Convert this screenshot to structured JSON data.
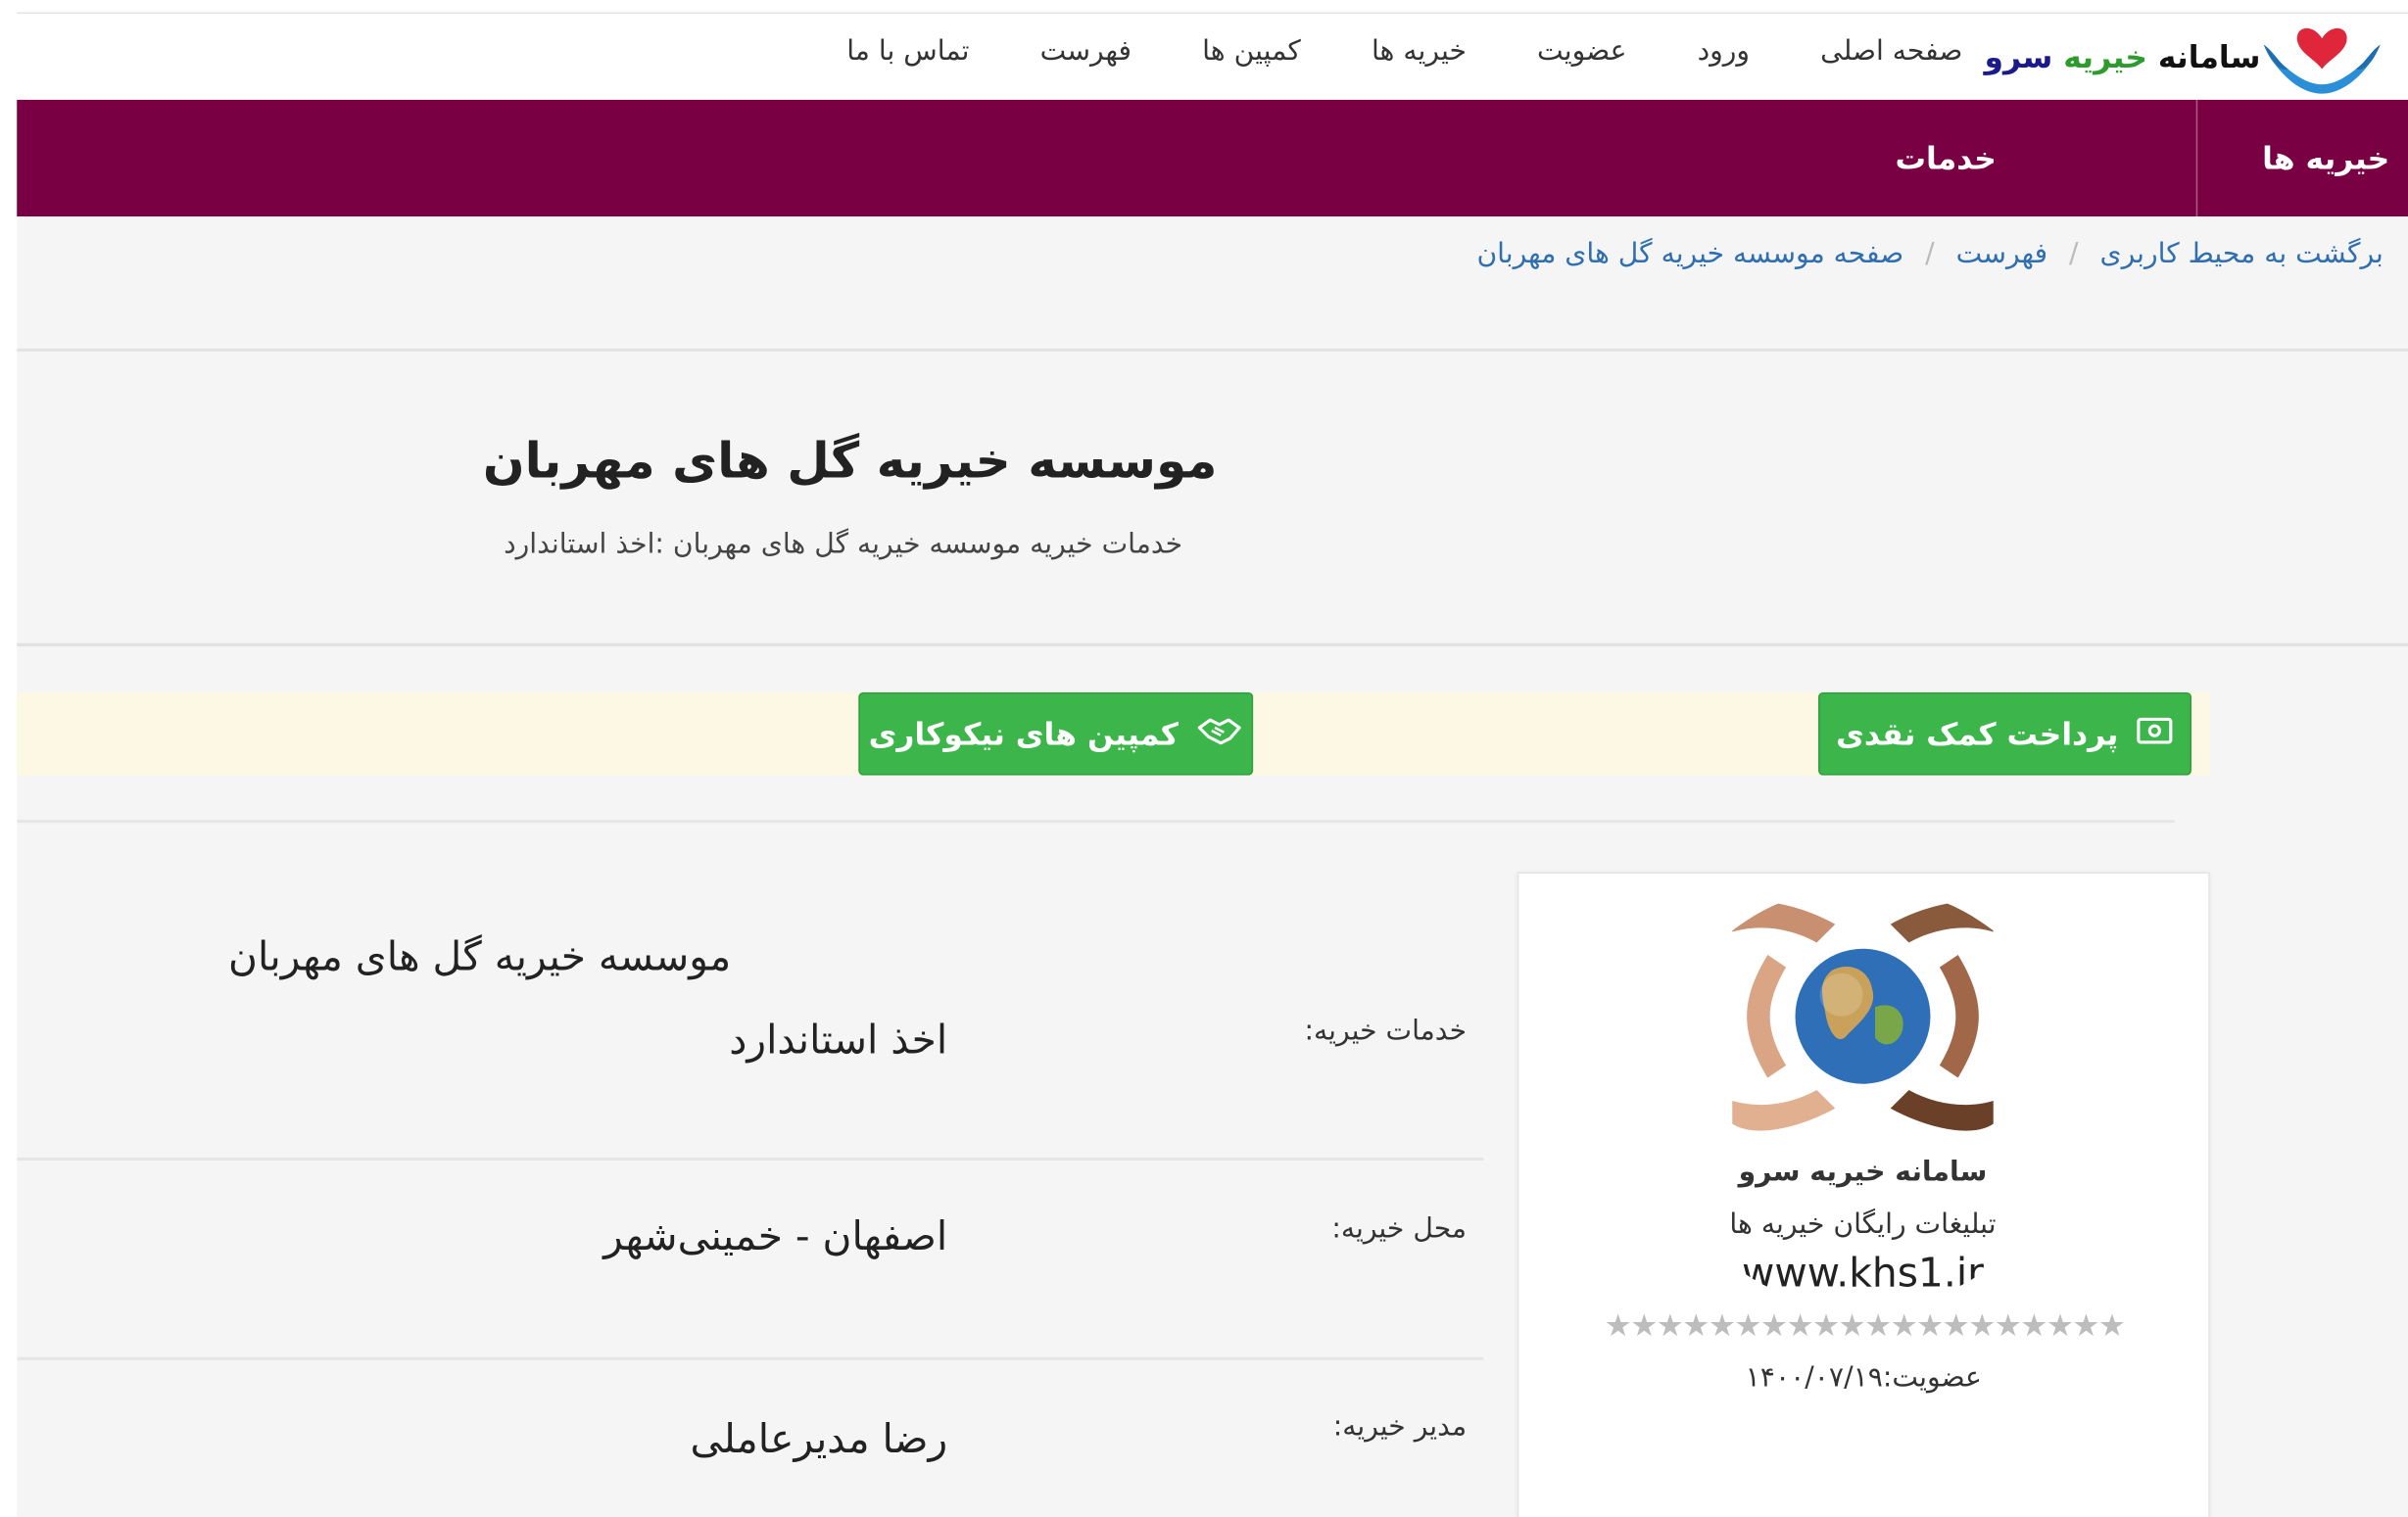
{
  "header": {
    "logo": {
      "text_part1": "سامانه",
      "text_part2": "خیریه",
      "text_part3": "سرو",
      "icon": "heart-hands-icon"
    },
    "nav": [
      "صفحه اصلی",
      "ورود",
      "عضویت",
      "خیریه ها",
      "کمپین ها",
      "فهرست",
      "تماس با ما"
    ]
  },
  "purplebar": {
    "item1": "خیریه ها",
    "item2": "خدمات",
    "bg_color": "#7a0044"
  },
  "breadcrumb": {
    "item1": "برگشت به محیط کاربری",
    "item2": "فهرست",
    "item3": "صفحه موسسه خیریه گل های مهربان",
    "separator": "/"
  },
  "main": {
    "title": "موسسه خیریه گل های مهربان",
    "subtitle": "خدمات خیریه موسسه خیریه گل های مهربان :اخذ استاندارد",
    "buttons": {
      "donate": {
        "label": "پرداخت کمک نقدی",
        "icon": "money-icon"
      },
      "campaigns": {
        "label": "کمپین های نیکوکاری",
        "icon": "handshake-icon"
      }
    },
    "accent_color": "#3cb54a"
  },
  "card": {
    "line1": "سامانه خیریه سرو",
    "line2": "تبلیغات رایگان خیریه ها",
    "line3": "www.khs1.ir",
    "stars": "★★★★★★★★★★★★★★★★★★★★",
    "membership": "عضویت:۱۴۰۰/۰۷/۱۹"
  },
  "details": {
    "name": "موسسه خیریه گل های مهربان",
    "services_label": "خدمات خیریه:",
    "services_value": "اخذ استاندارد",
    "location_label": "محل خیریه:",
    "location_value": "اصفهان - خمینی‌شهر",
    "manager_label": "مدیر خیریه:",
    "manager_value": "رضا مدیرعاملی"
  }
}
